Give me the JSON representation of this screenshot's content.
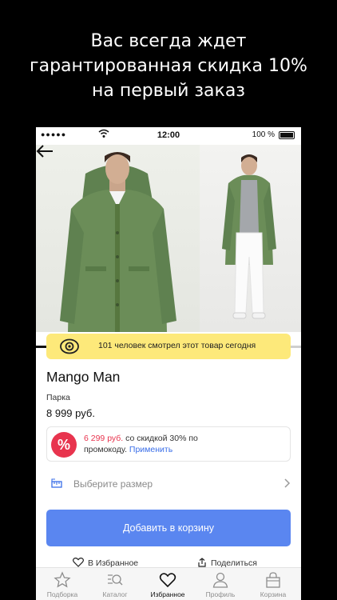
{
  "headline": {
    "line1": "Вас всегда ждет",
    "line2": "гарантированная скидка 10%",
    "line3": "на первый заказ"
  },
  "status_bar": {
    "signal_dots": "●●●●●",
    "time": "12:00",
    "battery": "100 %"
  },
  "gallery": {
    "image_count": 2,
    "progress": 0.62
  },
  "viewers_banner": {
    "text": "101 человек смотрел этот товар сегодня",
    "bg_color": "#fde97a"
  },
  "product": {
    "brand": "Mango Man",
    "category": "Парка",
    "price": "8 999 руб."
  },
  "promo": {
    "badge": "%",
    "discount_price": "6 299 руб.",
    "text_a": " со скидкой 30% по",
    "text_b": "промокоду. ",
    "apply_link": "Применить",
    "badge_color": "#e8344e"
  },
  "size_selector": {
    "placeholder": "Выберите размер"
  },
  "add_to_cart": {
    "label": "Добавить в корзину",
    "color": "#5a86f0"
  },
  "actions": {
    "favorite": "В Избранное",
    "share": "Поделиться"
  },
  "tabbar": {
    "tabs": [
      {
        "label": "Подборка",
        "icon": "star-icon",
        "active": false
      },
      {
        "label": "Каталог",
        "icon": "catalog-search-icon",
        "active": false
      },
      {
        "label": "Избранное",
        "icon": "heart-icon",
        "active": true
      },
      {
        "label": "Профиль",
        "icon": "person-icon",
        "active": false
      },
      {
        "label": "Корзина",
        "icon": "bag-icon",
        "active": false
      }
    ]
  }
}
